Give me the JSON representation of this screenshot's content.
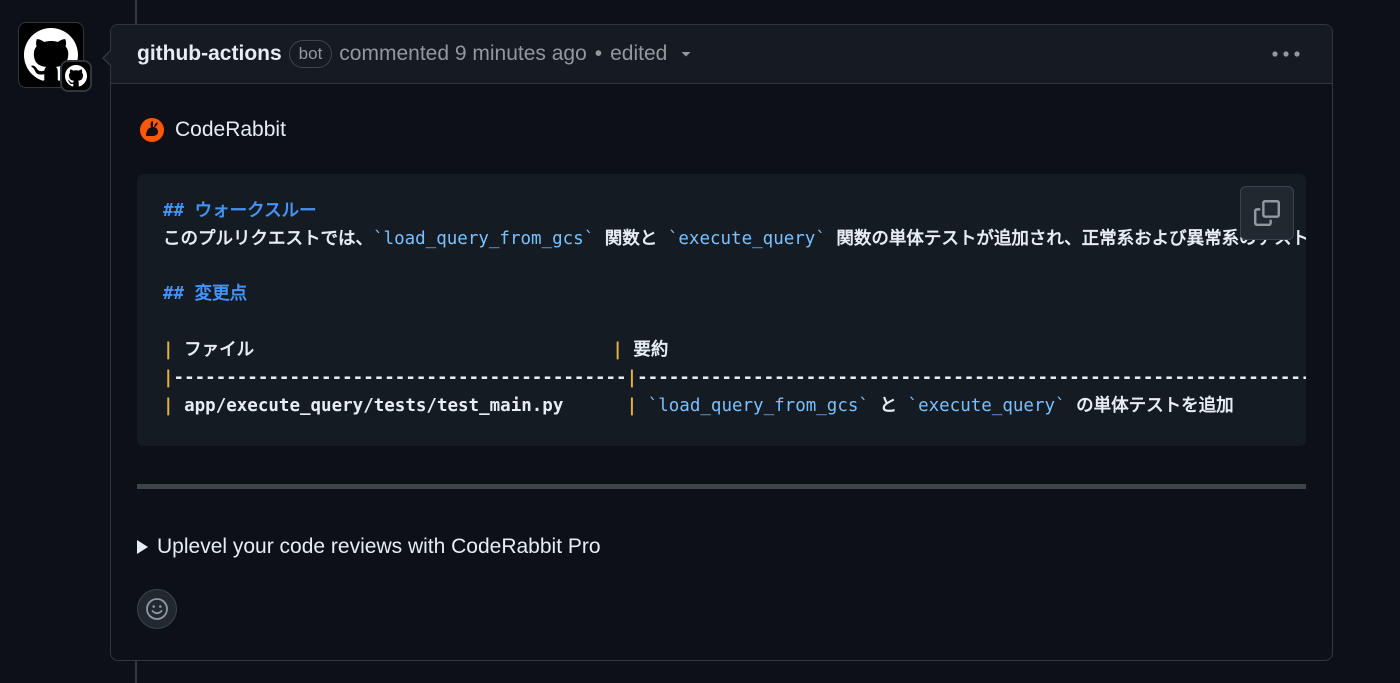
{
  "comment": {
    "author": "github-actions",
    "badge": "bot",
    "action": "commented 9 minutes ago",
    "separator": "•",
    "edited": "edited"
  },
  "app": {
    "name": "CodeRabbit"
  },
  "code": {
    "walkthrough_heading_marker": "##",
    "walkthrough_heading": "ウォークスルー",
    "summary_prefix": "このプルリクエストでは、",
    "summary_code1": "`load_query_from_gcs`",
    "summary_mid": " 関数と ",
    "summary_code2": "`execute_query`",
    "summary_suffix": " 関数の単体テストが追加され、正常系および異常系のテストケースが実装されています。",
    "changes_heading_marker": "##",
    "changes_heading": "変更点",
    "table_header_col1": " ファイル                                  ",
    "table_header_col2": " 要約",
    "table_separator_col1": "-------------------------------------------",
    "table_separator_col2": "------------------------------------------------------------------------",
    "row_file": " app/execute_query/tests/test_main.py      ",
    "row_code1": "`load_query_from_gcs`",
    "row_mid": " と ",
    "row_code2": "`execute_query`",
    "row_suffix": " の単体テストを追加",
    "pipe": "|"
  },
  "details": {
    "summary": "Uplevel your code reviews with CodeRabbit Pro"
  },
  "colors": {
    "background": "#0d1117",
    "header": "#161b22",
    "border": "#30363d",
    "heading_blue": "#4493f8",
    "inline_code": "#79c0ff",
    "pipe_yellow": "#e3b341",
    "rabbit_orange": "#ff570a"
  },
  "icons": {
    "avatar": "github-mark-icon",
    "avatar_badge": "github-app-icon",
    "kebab": "kebab-horizontal-icon",
    "chevron": "triangle-down-icon",
    "app_logo": "coderabbit-icon",
    "copy": "copy-icon",
    "details_toggle": "triangle-right-icon",
    "reaction": "smiley-icon"
  }
}
